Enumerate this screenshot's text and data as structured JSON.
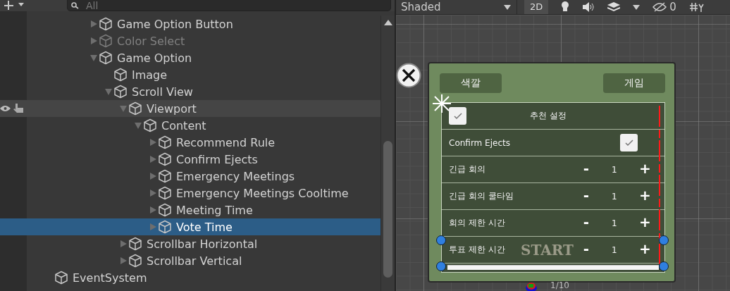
{
  "hierarchy": {
    "search": {
      "placeholder": "All"
    },
    "items": [
      {
        "label": "Game Option Button",
        "has_children": true,
        "expanded": false,
        "disabled": false,
        "selected": false,
        "hovered": false
      },
      {
        "label": "Color Select",
        "has_children": true,
        "expanded": false,
        "disabled": true,
        "selected": false,
        "hovered": false
      },
      {
        "label": "Game Option",
        "has_children": true,
        "expanded": true,
        "disabled": false,
        "selected": false,
        "hovered": false,
        "children": [
          {
            "label": "Image",
            "has_children": false,
            "disabled": false,
            "selected": false,
            "hovered": false
          },
          {
            "label": "Scroll View",
            "has_children": true,
            "expanded": true,
            "disabled": false,
            "selected": false,
            "hovered": false,
            "children": [
              {
                "label": "Viewport",
                "has_children": true,
                "expanded": true,
                "disabled": false,
                "selected": false,
                "hovered": true,
                "children": [
                  {
                    "label": "Content",
                    "has_children": true,
                    "expanded": true,
                    "disabled": false,
                    "selected": false,
                    "hovered": false,
                    "children": [
                      {
                        "label": "Recommend Rule",
                        "has_children": true,
                        "expanded": false,
                        "disabled": false,
                        "selected": false,
                        "hovered": false
                      },
                      {
                        "label": "Confirm Ejects",
                        "has_children": true,
                        "expanded": false,
                        "disabled": false,
                        "selected": false,
                        "hovered": false
                      },
                      {
                        "label": "Emergency Meetings",
                        "has_children": true,
                        "expanded": false,
                        "disabled": false,
                        "selected": false,
                        "hovered": false
                      },
                      {
                        "label": "Emergency Meetings Cooltime",
                        "has_children": true,
                        "expanded": false,
                        "disabled": false,
                        "selected": false,
                        "hovered": false
                      },
                      {
                        "label": "Meeting Time",
                        "has_children": true,
                        "expanded": false,
                        "disabled": false,
                        "selected": false,
                        "hovered": false
                      },
                      {
                        "label": "Vote Time",
                        "has_children": true,
                        "expanded": false,
                        "disabled": false,
                        "selected": true,
                        "hovered": false
                      }
                    ]
                  }
                ]
              },
              {
                "label": "Scrollbar Horizontal",
                "has_children": true,
                "expanded": false,
                "disabled": false,
                "selected": false,
                "hovered": false
              },
              {
                "label": "Scrollbar Vertical",
                "has_children": true,
                "expanded": false,
                "disabled": false,
                "selected": false,
                "hovered": false
              }
            ]
          }
        ]
      }
    ],
    "root_items": [
      {
        "label": "EventSystem",
        "has_children": false,
        "disabled": false,
        "selected": false,
        "hovered": false
      }
    ]
  },
  "scene_toolbar": {
    "shading": "Shaded",
    "mode_2d": {
      "label": "2D",
      "on": true
    },
    "hidden_count": "0"
  },
  "game_panel": {
    "tabs": [
      {
        "label": "색깔",
        "selected": false
      },
      {
        "label": "게임",
        "selected": false
      }
    ],
    "options": [
      {
        "kind": "header_toggle",
        "label": "추천 설정",
        "checked": true
      },
      {
        "kind": "toggle",
        "label": "Confirm Ejects",
        "checked": true
      },
      {
        "kind": "stepper",
        "label": "긴급 회의",
        "minus": "-",
        "value": "1",
        "plus": "+"
      },
      {
        "kind": "stepper",
        "label": "긴급 회의 쿨타임",
        "minus": "-",
        "value": "1",
        "plus": "+"
      },
      {
        "kind": "stepper",
        "label": "회의 제한 시간",
        "minus": "-",
        "value": "1",
        "plus": "+"
      },
      {
        "kind": "stepper",
        "label": "투표 제한 시간",
        "minus": "-",
        "value": "1",
        "plus": "+"
      }
    ],
    "start_logo": "START",
    "page": "1/10"
  }
}
